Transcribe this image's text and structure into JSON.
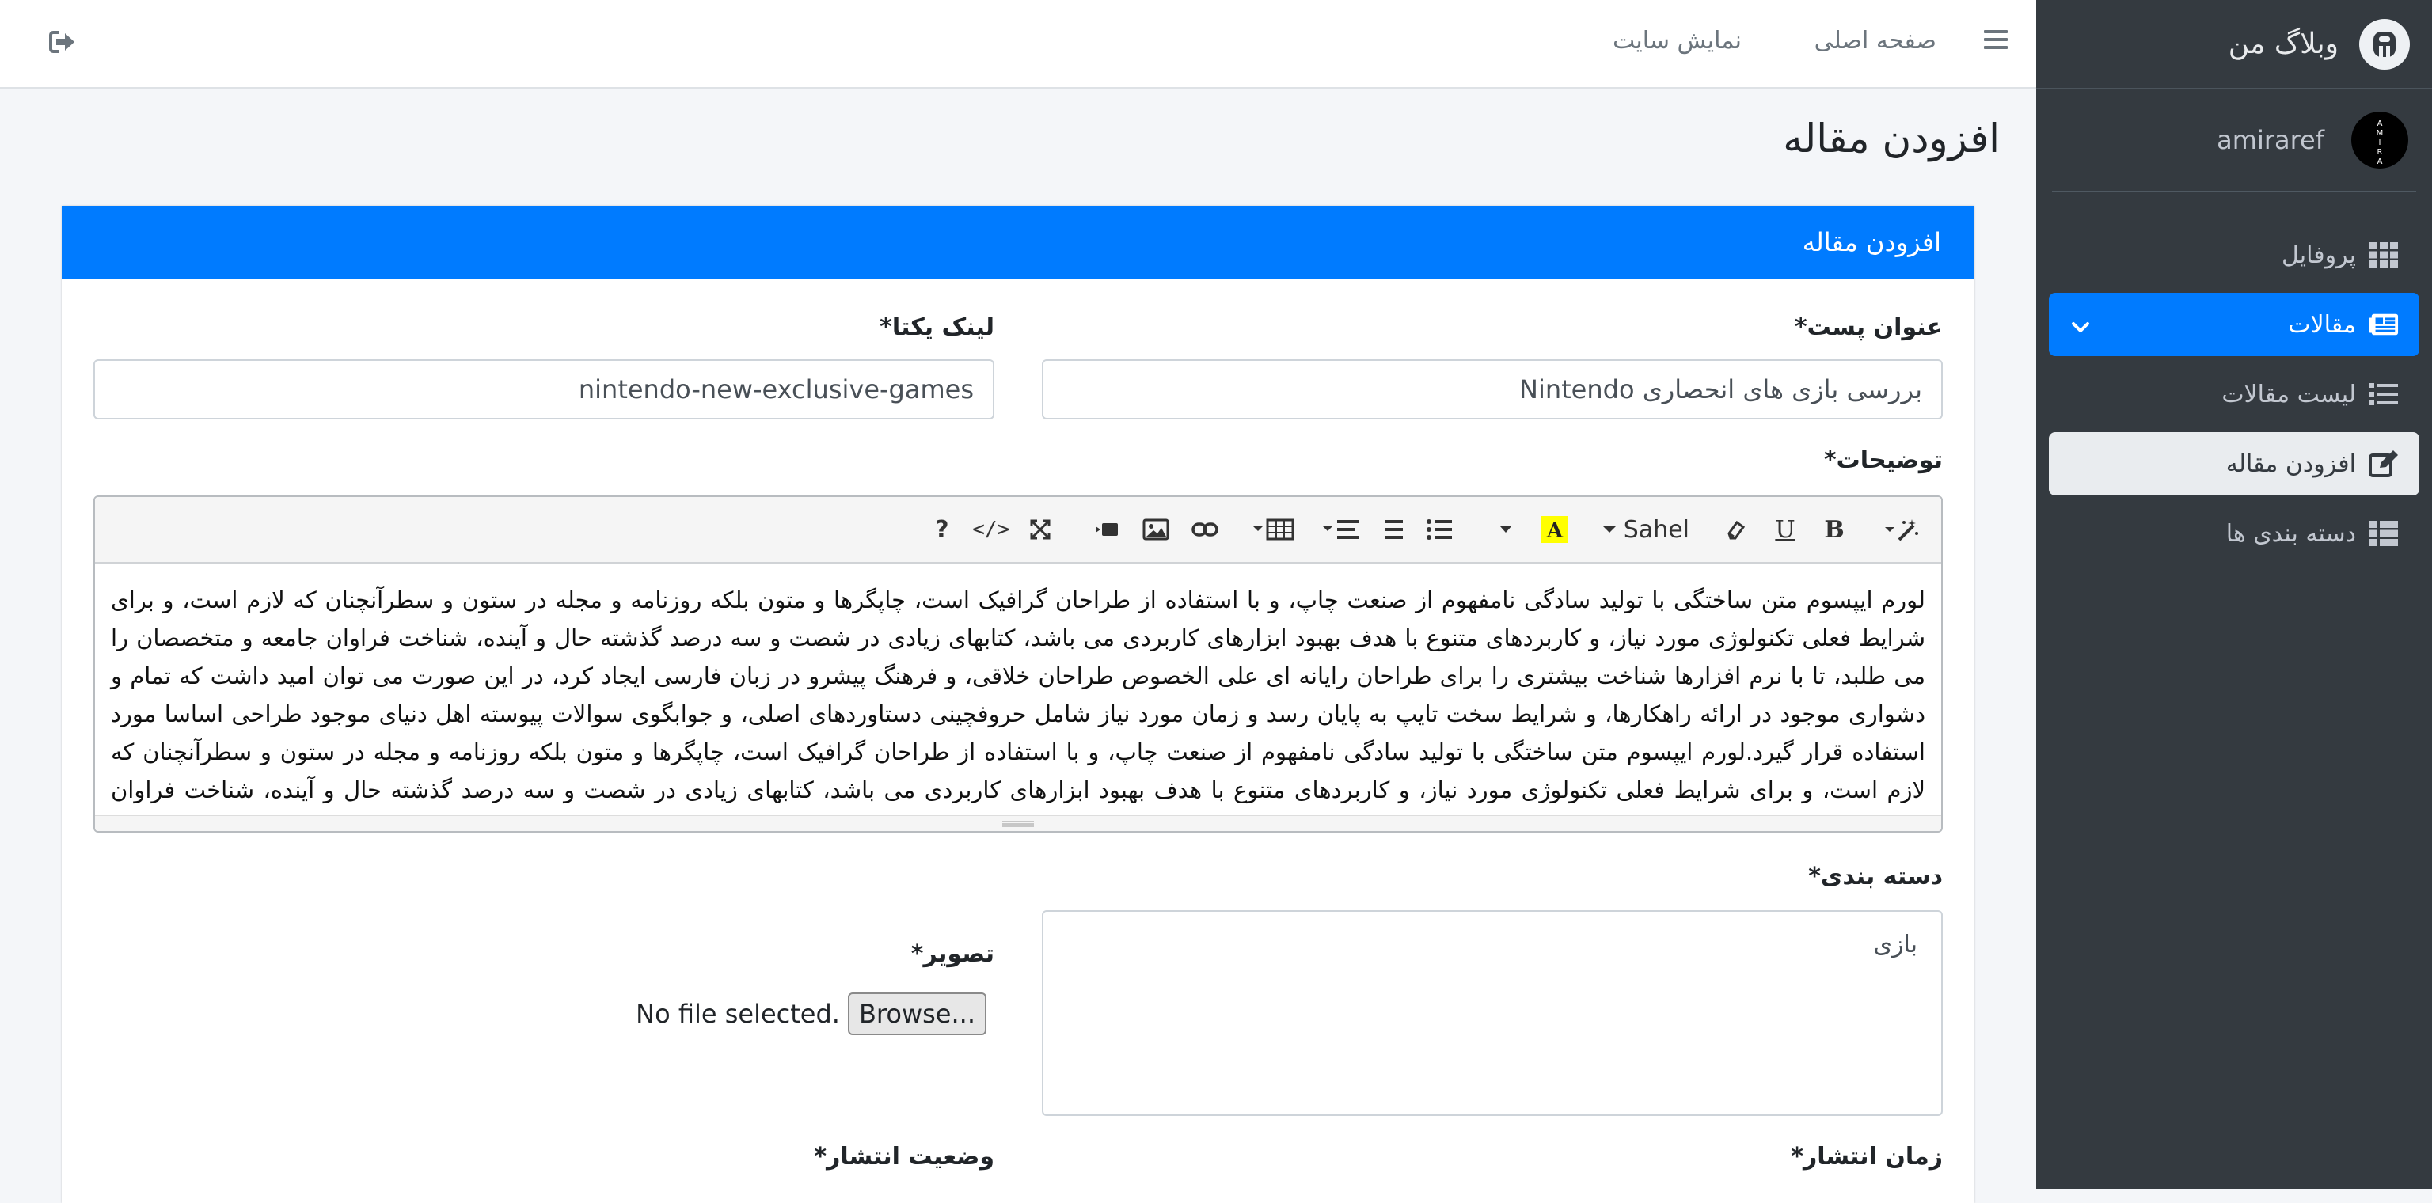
{
  "sidebar": {
    "brand": "وبلاگ من",
    "user_name": "amiraref",
    "items": [
      {
        "label": "پروفایل",
        "icon": "grid-icon"
      },
      {
        "label": "مقالات",
        "icon": "newspaper-icon"
      },
      {
        "label": "لیست مقالات",
        "icon": "list-icon"
      },
      {
        "label": "افزودن مقاله",
        "icon": "edit-icon"
      },
      {
        "label": "دسته بندی ها",
        "icon": "table-icon"
      }
    ]
  },
  "topbar": {
    "home_link": "صفحه اصلی",
    "view_site_link": "نمایش سایت"
  },
  "page": {
    "title": "افزودن مقاله",
    "card_title": "افزودن مقاله"
  },
  "form": {
    "title_label": "عنوان پست*",
    "title_value": "بررسی بازی های انحصاری Nintendo",
    "slug_label": "لینک یکتا*",
    "slug_value": "nintendo-new-exclusive-games",
    "description_label": "توضیحات*",
    "font_select": "Sahel",
    "description_text": "لورم ایپسوم متن ساختگی با تولید سادگی نامفهوم از صنعت چاپ، و با استفاده از طراحان گرافیک است، چاپگرها و متون بلکه روزنامه و مجله در ستون و سطرآنچنان که لازم است، و برای شرایط فعلی تکنولوژی مورد نیاز، و کاربردهای متنوع با هدف بهبود ابزارهای کاربردی می باشد، کتابهای زیادی در شصت و سه درصد گذشته حال و آینده، شناخت فراوان جامعه و متخصصان را می طلبد، تا با نرم افزارها شناخت بیشتری را برای طراحان رایانه ای علی الخصوص طراحان خلاقی، و فرهنگ پیشرو در زبان فارسی ایجاد کرد، در این صورت می توان امید داشت که تمام و دشواری موجود در ارائه راهکارها، و شرایط سخت تایپ به پایان رسد و زمان مورد نیاز شامل حروفچینی دستاوردهای اصلی، و جوابگوی سوالات پیوسته اهل دنیای موجود طراحی اساسا مورد استفاده قرار گیرد.لورم ایپسوم متن ساختگی با تولید سادگی نامفهوم از صنعت چاپ، و با استفاده از طراحان گرافیک است، چاپگرها و متون بلکه روزنامه و مجله در ستون و سطرآنچنان که لازم است، و برای شرایط فعلی تکنولوژی مورد نیاز، و کاربردهای متنوع با هدف بهبود ابزارهای کاربردی می باشد، کتابهای زیادی در شصت و سه درصد گذشته حال و آینده، شناخت فراوان جامعه و",
    "category_label": "دسته بندی*",
    "category_value": "بازی",
    "image_label": "تصویر*",
    "browse_button": "Browse...",
    "no_file": "No file selected.",
    "publish_time_label": "زمان انتشار*",
    "publish_status_label": "وضعیت انتشار*"
  }
}
